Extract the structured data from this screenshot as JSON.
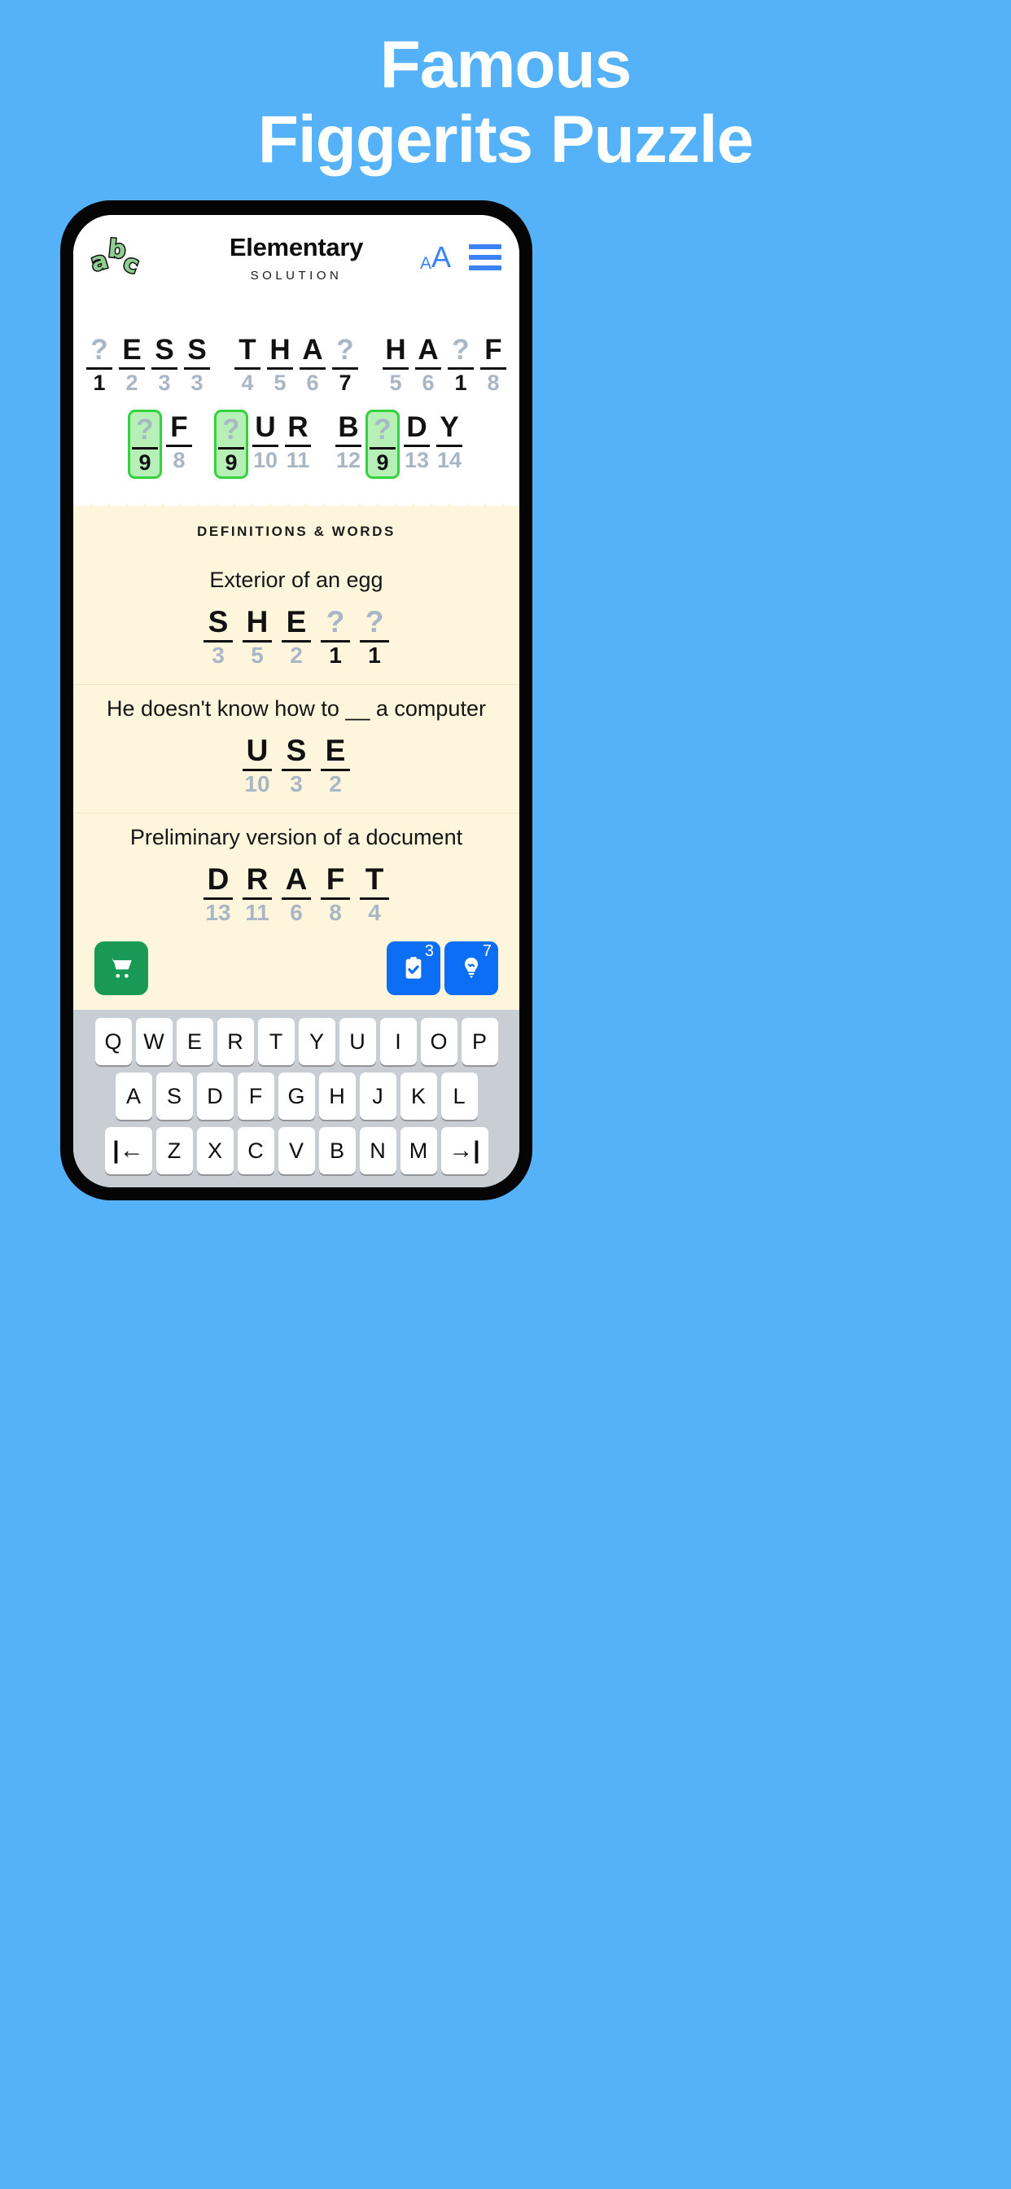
{
  "promo": {
    "line1": "Famous",
    "line2": "Figgerits Puzzle",
    "background_color": "#55b2f8",
    "text_color": "#ffffff"
  },
  "app": {
    "logo": {
      "name": "abc-logo",
      "letters": [
        "a",
        "b",
        "c"
      ],
      "color": "#8fce8f"
    },
    "header": {
      "title": "Elementary",
      "subtitle": "SOLUTION",
      "font_size_icon_small": "A",
      "font_size_icon_large": "A",
      "menu_icon": "hamburger-icon",
      "accent_color": "#3b82f6"
    },
    "puzzle": {
      "rows": [
        {
          "groups": [
            {
              "cells": [
                {
                  "glyph": "?",
                  "num": "1",
                  "unknown": true,
                  "num_dark": true,
                  "highlight": false
                },
                {
                  "glyph": "E",
                  "num": "2",
                  "unknown": false,
                  "num_dark": false,
                  "highlight": false
                },
                {
                  "glyph": "S",
                  "num": "3",
                  "unknown": false,
                  "num_dark": false,
                  "highlight": false
                },
                {
                  "glyph": "S",
                  "num": "3",
                  "unknown": false,
                  "num_dark": false,
                  "highlight": false
                }
              ]
            },
            {
              "cells": [
                {
                  "glyph": "T",
                  "num": "4",
                  "unknown": false,
                  "num_dark": false,
                  "highlight": false
                },
                {
                  "glyph": "H",
                  "num": "5",
                  "unknown": false,
                  "num_dark": false,
                  "highlight": false
                },
                {
                  "glyph": "A",
                  "num": "6",
                  "unknown": false,
                  "num_dark": false,
                  "highlight": false
                },
                {
                  "glyph": "?",
                  "num": "7",
                  "unknown": true,
                  "num_dark": true,
                  "highlight": false
                }
              ]
            },
            {
              "cells": [
                {
                  "glyph": "H",
                  "num": "5",
                  "unknown": false,
                  "num_dark": false,
                  "highlight": false
                },
                {
                  "glyph": "A",
                  "num": "6",
                  "unknown": false,
                  "num_dark": false,
                  "highlight": false
                },
                {
                  "glyph": "?",
                  "num": "1",
                  "unknown": true,
                  "num_dark": true,
                  "highlight": false
                },
                {
                  "glyph": "F",
                  "num": "8",
                  "unknown": false,
                  "num_dark": false,
                  "highlight": false
                }
              ]
            }
          ]
        },
        {
          "groups": [
            {
              "cells": [
                {
                  "glyph": "?",
                  "num": "9",
                  "unknown": true,
                  "num_dark": true,
                  "highlight": true
                },
                {
                  "glyph": "F",
                  "num": "8",
                  "unknown": false,
                  "num_dark": false,
                  "highlight": false
                }
              ]
            },
            {
              "cells": [
                {
                  "glyph": "?",
                  "num": "9",
                  "unknown": true,
                  "num_dark": true,
                  "highlight": true
                },
                {
                  "glyph": "U",
                  "num": "10",
                  "unknown": false,
                  "num_dark": false,
                  "highlight": false
                },
                {
                  "glyph": "R",
                  "num": "11",
                  "unknown": false,
                  "num_dark": false,
                  "highlight": false
                }
              ]
            },
            {
              "cells": [
                {
                  "glyph": "B",
                  "num": "12",
                  "unknown": false,
                  "num_dark": false,
                  "highlight": false
                },
                {
                  "glyph": "?",
                  "num": "9",
                  "unknown": true,
                  "num_dark": true,
                  "highlight": true
                },
                {
                  "glyph": "D",
                  "num": "13",
                  "unknown": false,
                  "num_dark": false,
                  "highlight": false
                },
                {
                  "glyph": "Y",
                  "num": "14",
                  "unknown": false,
                  "num_dark": false,
                  "highlight": false
                }
              ]
            }
          ]
        }
      ],
      "highlight_fill": "#b6f0b6",
      "highlight_border": "#35d13f"
    },
    "definitions": {
      "heading": "DEFINITIONS & WORDS",
      "items": [
        {
          "clue": "Exterior of an egg",
          "answer": [
            {
              "glyph": "S",
              "num": "3",
              "unknown": false,
              "num_dark": false
            },
            {
              "glyph": "H",
              "num": "5",
              "unknown": false,
              "num_dark": false
            },
            {
              "glyph": "E",
              "num": "2",
              "unknown": false,
              "num_dark": false
            },
            {
              "glyph": "?",
              "num": "1",
              "unknown": true,
              "num_dark": true
            },
            {
              "glyph": "?",
              "num": "1",
              "unknown": true,
              "num_dark": true
            }
          ]
        },
        {
          "clue": "He doesn't know how to __ a computer",
          "answer": [
            {
              "glyph": "U",
              "num": "10",
              "unknown": false,
              "num_dark": false
            },
            {
              "glyph": "S",
              "num": "3",
              "unknown": false,
              "num_dark": false
            },
            {
              "glyph": "E",
              "num": "2",
              "unknown": false,
              "num_dark": false
            }
          ]
        },
        {
          "clue": "Preliminary version of a document",
          "answer": [
            {
              "glyph": "D",
              "num": "13",
              "unknown": false,
              "num_dark": false
            },
            {
              "glyph": "R",
              "num": "11",
              "unknown": false,
              "num_dark": false
            },
            {
              "glyph": "A",
              "num": "6",
              "unknown": false,
              "num_dark": false
            },
            {
              "glyph": "F",
              "num": "8",
              "unknown": false,
              "num_dark": false
            },
            {
              "glyph": "T",
              "num": "4",
              "unknown": false,
              "num_dark": false
            }
          ]
        }
      ]
    },
    "actions": {
      "cart": {
        "icon": "shopping-cart-icon",
        "color": "#189a54"
      },
      "check": {
        "icon": "clipboard-check-icon",
        "badge": "3",
        "color": "#0b6ef4"
      },
      "hint": {
        "icon": "lightbulb-icon",
        "badge": "7",
        "color": "#0b6ef4"
      }
    },
    "keyboard": {
      "rows": [
        [
          "Q",
          "W",
          "E",
          "R",
          "T",
          "Y",
          "U",
          "I",
          "O",
          "P"
        ],
        [
          "A",
          "S",
          "D",
          "F",
          "G",
          "H",
          "J",
          "K",
          "L"
        ],
        [
          "|←",
          "Z",
          "X",
          "C",
          "V",
          "B",
          "N",
          "M",
          "→|"
        ]
      ]
    }
  }
}
